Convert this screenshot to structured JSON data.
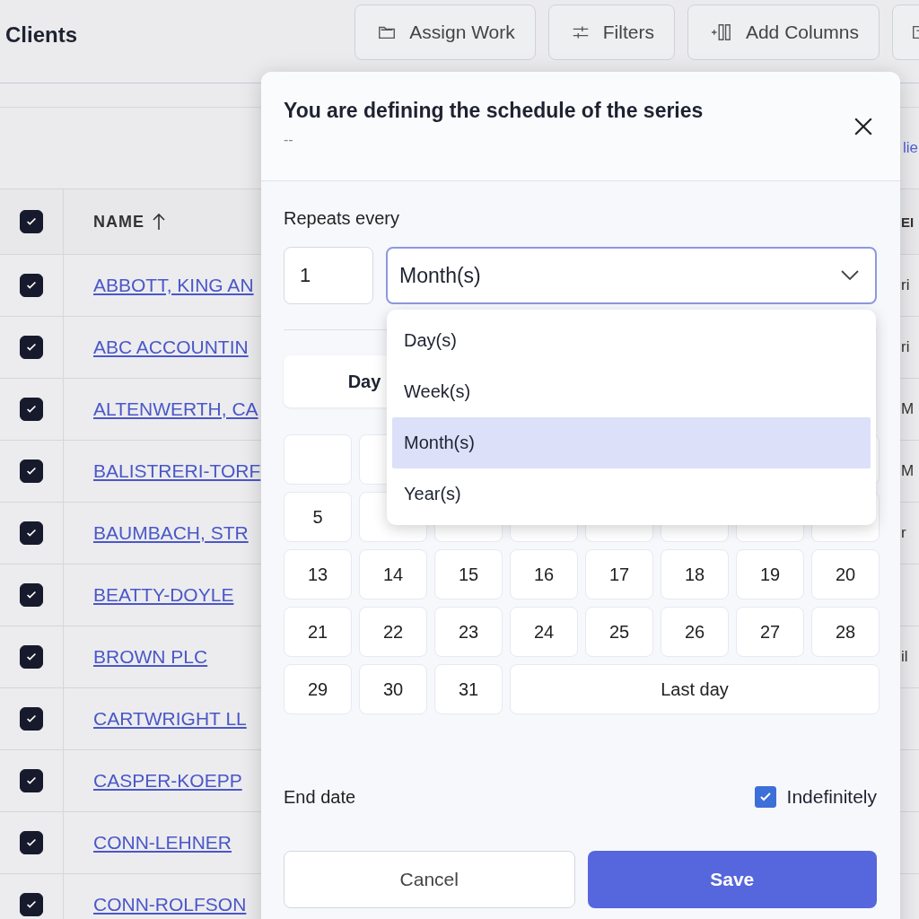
{
  "header": {
    "title": "Clients",
    "buttons": [
      {
        "kind": "assign",
        "label": "Assign Work"
      },
      {
        "kind": "filters",
        "label": "Filters"
      },
      {
        "kind": "columns",
        "label": "Add Columns"
      },
      {
        "kind": "export"
      }
    ]
  },
  "toolbar_link": "lie",
  "table": {
    "header_checked": true,
    "columns": [
      "NAME",
      "EI"
    ],
    "rows": [
      {
        "checked": true,
        "name": "ABBOTT, KING AN",
        "column_3": "ri"
      },
      {
        "checked": true,
        "name": "ABC ACCOUNTIN",
        "column_3": "ri"
      },
      {
        "checked": true,
        "name": "ALTENWERTH, CA",
        "column_3": "M"
      },
      {
        "checked": true,
        "name": "BALISTRERI-TORF",
        "column_3": "M"
      },
      {
        "checked": true,
        "name": "BAUMBACH, STR",
        "column_3": "r"
      },
      {
        "checked": true,
        "name": "BEATTY-DOYLE"
      },
      {
        "checked": true,
        "name": "BROWN PLC",
        "column_3": "il"
      },
      {
        "checked": true,
        "name": "CARTWRIGHT LL"
      },
      {
        "checked": true,
        "name": "CASPER-KOEPP"
      },
      {
        "checked": true,
        "name": "CONN-LEHNER"
      },
      {
        "checked": true,
        "name": "CONN-ROLFSON"
      }
    ]
  },
  "modal": {
    "title": "You are defining the schedule of the series",
    "subtitle": "--",
    "repeats_label": "Repeats every",
    "interval": "1",
    "unit": "Month(s)",
    "options": [
      {
        "label": "Day(s)",
        "selected": false
      },
      {
        "label": "Week(s)",
        "selected": false
      },
      {
        "label": "Month(s)",
        "selected": true
      },
      {
        "label": "Year(s)",
        "selected": false
      }
    ],
    "segment": {
      "label": "Day",
      "selected": true
    },
    "days": [
      "5",
      "13",
      "14",
      "15",
      "16",
      "17",
      "18",
      "19",
      "20",
      "21",
      "22",
      "23",
      "24",
      "25",
      "26",
      "27",
      "28",
      "29",
      "30",
      "31"
    ],
    "last_day": "Last day",
    "end_date_label": "End date",
    "indefinitely": {
      "label": "Indefinitely",
      "checked": true
    },
    "buttons": [
      {
        "kind": "secondary",
        "label": "Cancel"
      },
      {
        "kind": "primary",
        "label": "Save"
      }
    ]
  }
}
